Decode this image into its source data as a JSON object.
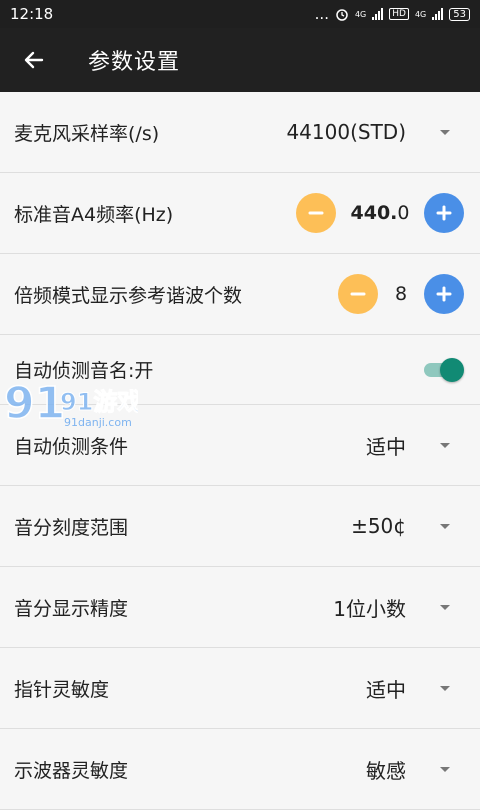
{
  "status_bar": {
    "time": "12:18",
    "dots": "...",
    "net1": "4G",
    "hd": "HD",
    "net2": "4G",
    "battery": "53"
  },
  "toolbar": {
    "title": "参数设置"
  },
  "settings": {
    "sample_rate": {
      "label": "麦克风采样率(/s)",
      "value": "44100(STD)"
    },
    "a4_freq": {
      "label": "标准音A4频率(Hz)",
      "value_main": "440.",
      "value_decimal": "0"
    },
    "harmonics": {
      "label": "倍频模式显示参考谐波个数",
      "value": "8"
    },
    "auto_detect": {
      "label": "自动侦测音名:开",
      "enabled": true
    },
    "detect_condition": {
      "label": "自动侦测条件",
      "value": "适中"
    },
    "cents_range": {
      "label": "音分刻度范围",
      "value": "±50¢"
    },
    "cents_precision": {
      "label": "音分显示精度",
      "value": "1位小数"
    },
    "needle_sensitivity": {
      "label": "指针灵敏度",
      "value": "适中"
    },
    "scope_sensitivity": {
      "label": "示波器灵敏度",
      "value": "敏感"
    }
  },
  "watermark": {
    "text": "91游戏",
    "url": "91danji.com"
  },
  "colors": {
    "minus": "#fdbf57",
    "plus": "#4a8fe7",
    "toggle_on": "#118a74",
    "toolbar": "#212121"
  }
}
